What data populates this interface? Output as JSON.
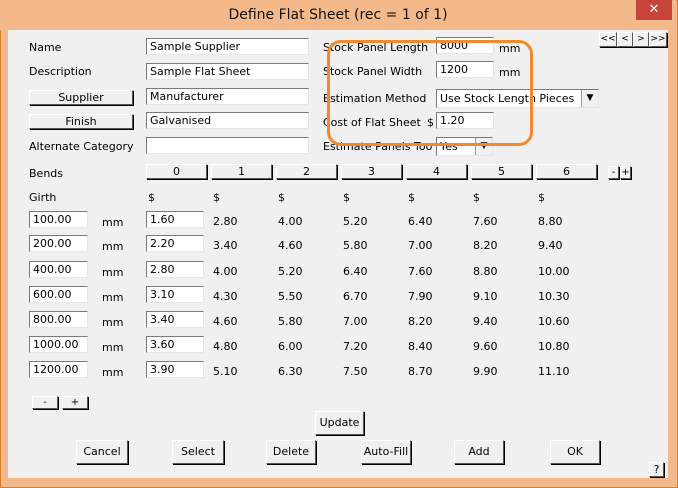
{
  "window": {
    "title": "Define Flat Sheet (rec = 1 of 1)",
    "close_glyph": "✕"
  },
  "nav": {
    "first": "<<",
    "prev": "<",
    "next": ">",
    "last": ">>"
  },
  "fields": {
    "name_label": "Name",
    "name_value": "Sample Supplier",
    "description_label": "Description",
    "description_value": "Sample Flat Sheet",
    "supplier_button": "Supplier",
    "supplier_value": "Manufacturer",
    "finish_button": "Finish",
    "finish_value": "Galvanised",
    "alt_category_label": "Alternate Category",
    "alt_category_value": ""
  },
  "stock": {
    "length_label": "Stock Panel Length",
    "length_value": "8000",
    "length_unit": "mm",
    "width_label": "Stock Panel Width",
    "width_value": "1200",
    "width_unit": "mm",
    "method_label": "Estimation Method",
    "method_value": "Use Stock Length Pieces",
    "cost_label": "Cost of Flat Sheet",
    "cost_currency": "$",
    "cost_value": "1.20",
    "estimate_label": "Estimate Panels Too ?",
    "estimate_value": "Yes"
  },
  "bends": {
    "label": "Bends",
    "buttons": [
      "0",
      "1",
      "2",
      "3",
      "4",
      "5",
      "6"
    ],
    "minus": "-",
    "plus": "+"
  },
  "table": {
    "girth_label": "Girth",
    "currency_headers": [
      "$",
      "$",
      "$",
      "$",
      "$",
      "$",
      "$"
    ],
    "unit": "mm",
    "rows": [
      {
        "girth": "100.00",
        "first": "1.60",
        "prices": [
          "2.80",
          "4.00",
          "5.20",
          "6.40",
          "7.60",
          "8.80"
        ]
      },
      {
        "girth": "200.00",
        "first": "2.20",
        "prices": [
          "3.40",
          "4.60",
          "5.80",
          "7.00",
          "8.20",
          "9.40"
        ]
      },
      {
        "girth": "400.00",
        "first": "2.80",
        "prices": [
          "4.00",
          "5.20",
          "6.40",
          "7.60",
          "8.80",
          "10.00"
        ]
      },
      {
        "girth": "600.00",
        "first": "3.10",
        "prices": [
          "4.30",
          "5.50",
          "6.70",
          "7.90",
          "9.10",
          "10.30"
        ]
      },
      {
        "girth": "800.00",
        "first": "3.40",
        "prices": [
          "4.60",
          "5.80",
          "7.00",
          "8.20",
          "9.40",
          "10.60"
        ]
      },
      {
        "girth": "1000.00",
        "first": "3.60",
        "prices": [
          "4.80",
          "6.00",
          "7.20",
          "8.40",
          "9.60",
          "10.80"
        ]
      },
      {
        "girth": "1200.00",
        "first": "3.90",
        "prices": [
          "5.10",
          "6.30",
          "7.50",
          "8.70",
          "9.90",
          "11.10"
        ]
      }
    ],
    "row_minus": "-",
    "row_plus": "+"
  },
  "actions": {
    "update": "Update",
    "cancel": "Cancel",
    "select": "Select",
    "delete": "Delete",
    "autofill": "Auto-Fill",
    "add": "Add",
    "ok": "OK",
    "help": "?"
  },
  "colors": {
    "title_bar": "#f4b98a",
    "highlight": "#f08a2a",
    "close": "#c7443a"
  }
}
